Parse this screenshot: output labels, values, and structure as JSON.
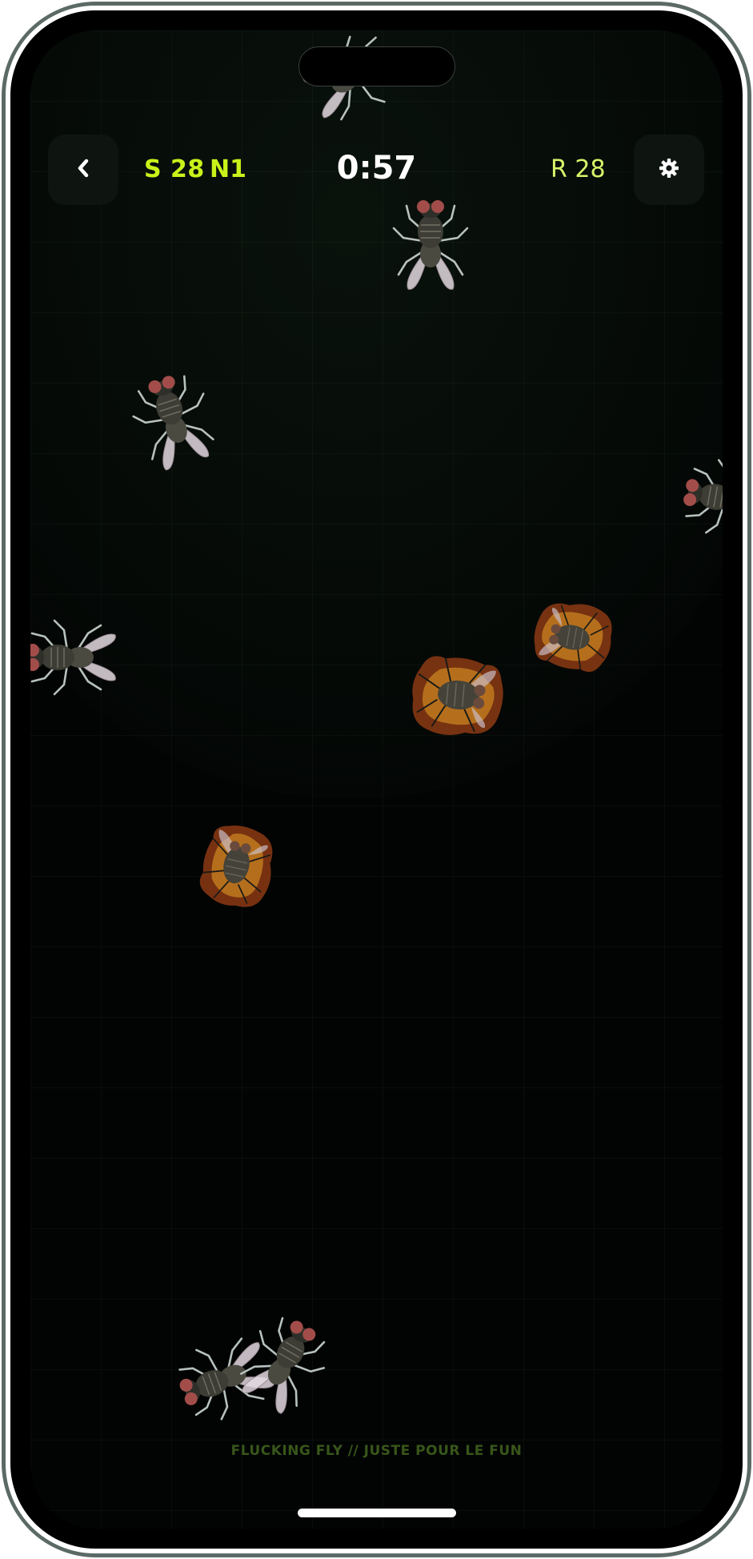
{
  "hud": {
    "back_icon": "chevron-left-icon",
    "score": "S 28",
    "level": "N1",
    "timer": "0:57",
    "record": "R 28",
    "settings_icon": "gear-icon"
  },
  "footer": {
    "text": "FLUCKING FLY  //  JUSTE POUR LE FUN"
  },
  "colors": {
    "accent": "#c9f21a",
    "background": "#020403",
    "button": "#0e1511"
  }
}
